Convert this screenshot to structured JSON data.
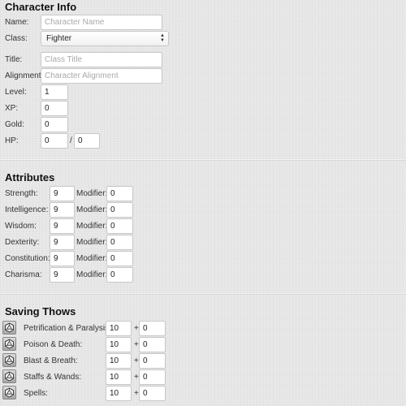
{
  "character_info": {
    "title": "Character Info",
    "name": {
      "label": "Name:",
      "value": "",
      "placeholder": "Character Name"
    },
    "class": {
      "label": "Class:",
      "selected": "Fighter"
    },
    "class_title": {
      "label": "Title:",
      "value": "",
      "placeholder": "Class Title"
    },
    "alignment": {
      "label": "Alignment:",
      "value": "",
      "placeholder": "Character Alignment"
    },
    "level": {
      "label": "Level:",
      "value": "1"
    },
    "xp": {
      "label": "XP:",
      "value": "0"
    },
    "gold": {
      "label": "Gold:",
      "value": "0"
    },
    "hp": {
      "label": "HP:",
      "current": "0",
      "separator": "/",
      "max": "0"
    }
  },
  "attributes": {
    "title": "Attributes",
    "modifier_label": "Modifier:",
    "items": [
      {
        "label": "Strength:",
        "value": "9",
        "modifier": "0"
      },
      {
        "label": "Intelligence:",
        "value": "9",
        "modifier": "0"
      },
      {
        "label": "Wisdom:",
        "value": "9",
        "modifier": "0"
      },
      {
        "label": "Dexterity:",
        "value": "9",
        "modifier": "0"
      },
      {
        "label": "Constitution:",
        "value": "9",
        "modifier": "0"
      },
      {
        "label": "Charisma:",
        "value": "9",
        "modifier": "0"
      }
    ]
  },
  "saving_throws": {
    "title": "Saving Thows",
    "plus": "+",
    "icon": "d20-die-icon",
    "items": [
      {
        "label": "Petrification & Paralysis:",
        "value": "10",
        "bonus": "0"
      },
      {
        "label": "Poison & Death:",
        "value": "10",
        "bonus": "0"
      },
      {
        "label": "Blast & Breath:",
        "value": "10",
        "bonus": "0"
      },
      {
        "label": "Staffs & Wands:",
        "value": "10",
        "bonus": "0"
      },
      {
        "label": "Spells:",
        "value": "10",
        "bonus": "0"
      }
    ]
  }
}
